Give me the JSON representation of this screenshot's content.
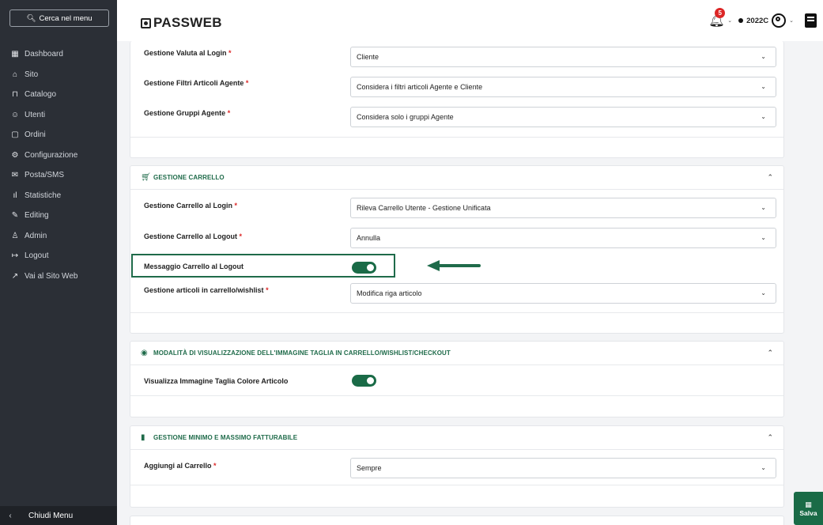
{
  "sidebar": {
    "search_label": "Cerca nel menu",
    "items": [
      {
        "label": "Dashboard",
        "icon": "dashboard-icon",
        "glyph": "▦"
      },
      {
        "label": "Sito",
        "icon": "home-icon",
        "glyph": "⌂"
      },
      {
        "label": "Catalogo",
        "icon": "cart-icon",
        "glyph": "⊓"
      },
      {
        "label": "Utenti",
        "icon": "users-icon",
        "glyph": "☺"
      },
      {
        "label": "Ordini",
        "icon": "file-icon",
        "glyph": "▢"
      },
      {
        "label": "Configurazione",
        "icon": "gear-icon",
        "glyph": "⚙"
      },
      {
        "label": "Posta/SMS",
        "icon": "mail-icon",
        "glyph": "✉"
      },
      {
        "label": "Statistiche",
        "icon": "stats-icon",
        "glyph": "ıl"
      },
      {
        "label": "Editing",
        "icon": "pencil-icon",
        "glyph": "✎"
      },
      {
        "label": "Admin",
        "icon": "admin-icon",
        "glyph": "♙"
      },
      {
        "label": "Logout",
        "icon": "logout-icon",
        "glyph": "↦"
      },
      {
        "label": "Vai al Sito Web",
        "icon": "external-link-icon",
        "glyph": "↗"
      }
    ],
    "footer_label": "Chiudi Menu"
  },
  "header": {
    "logo": "PASSWEB",
    "notification_count": "5",
    "user_code": "2022C"
  },
  "panel_top": {
    "rows": [
      {
        "label": "Gestione Valuta al Login",
        "value": "Cliente"
      },
      {
        "label": "Gestione Filtri Articoli Agente",
        "value": "Considera i filtri articoli Agente e Cliente"
      },
      {
        "label": "Gestione Gruppi Agente",
        "value": "Considera solo i gruppi Agente"
      }
    ]
  },
  "panel_carrello": {
    "title": "GESTIONE CARRELLO",
    "rows": [
      {
        "label": "Gestione Carrello al Login",
        "value": "Rileva Carrello Utente - Gestione Unificata"
      },
      {
        "label": "Gestione Carrello al Logout",
        "value": "Annulla"
      },
      {
        "label": "Messaggio Carrello al Logout",
        "toggle": true
      },
      {
        "label": "Gestione articoli in carrello/wishlist",
        "value": "Modifica riga articolo"
      }
    ]
  },
  "panel_immagine": {
    "title": "MODALITÀ DI VISUALIZZAZIONE DELL'IMMAGINE TAGLIA IN CARRELLO/WISHLIST/CHECKOUT",
    "rows": [
      {
        "label": "Visualizza Immagine Taglia Colore Articolo",
        "toggle": true
      }
    ]
  },
  "panel_minimo": {
    "title": "GESTIONE MINIMO E MASSIMO FATTURABILE",
    "rows": [
      {
        "label": "Aggiungi al Carrello",
        "value": "Sempre"
      }
    ]
  },
  "save_label": "Salva",
  "required_mark": "*",
  "colors": {
    "accent": "#1a6b47",
    "sidebar": "#2b2f36",
    "badge": "#dc2626"
  }
}
